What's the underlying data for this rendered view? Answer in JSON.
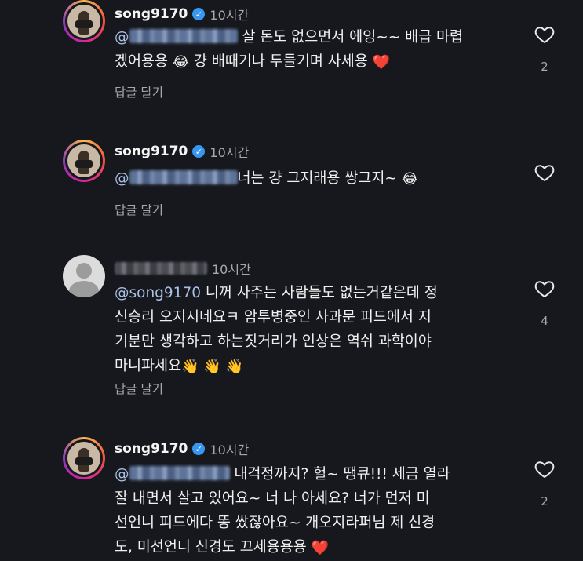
{
  "comments": [
    {
      "username": "song9170",
      "verified": true,
      "time": "10시간",
      "line1": "살 돈도 없으면서 에잉~~ 배급 마렵",
      "line2": "겠어용용",
      "line2b": "걍 배때기나 두들기며 사세용",
      "mention_prefix": "@",
      "reply_label": "답글 달기",
      "likes": "2",
      "emojis": [
        "😂",
        "❤️"
      ]
    },
    {
      "username": "song9170",
      "verified": true,
      "time": "10시간",
      "line1": "너는 걍 그지래용 쌍그지~",
      "mention_prefix": "@",
      "reply_label": "답글 달기",
      "likes": "",
      "emojis": [
        "😂"
      ]
    },
    {
      "username": "",
      "verified": false,
      "time": "10시간",
      "mention": "@song9170",
      "line1": " 니꺼 사주는 사람들도 없는거같은데 정",
      "line2": "신승리 오지시네요ㅋ 암투병중인 사과문 피드에서 지",
      "line3": "기분만 생각하고 하는짓거리가 인상은 역쉬 과학이야",
      "line4": "마니파세요",
      "reply_label": "답글 달기",
      "likes": "4",
      "emojis": [
        "👋",
        "👋",
        "👋"
      ]
    },
    {
      "username": "song9170",
      "verified": true,
      "time": "10시간",
      "line1": "내걱정까지? 헐~ 땡큐!!! 세금 열라",
      "line2": "잘 내면서 살고 있어요~ 너 나 아세요? 너가 먼저 미",
      "line3": "선언니 피드에다 똥 쌌잖아요~ 개오지라퍼님 제 신경",
      "line4": "도, 미선언니 신경도 끄세용용용",
      "mention_prefix": "@",
      "reply_label": "답글 달기",
      "likes": "2",
      "emojis": [
        "❤️"
      ]
    }
  ],
  "colors": {
    "background": "#16181d",
    "mention": "#a9bfe6",
    "verified": "#3897f0",
    "muted": "#a8a8a8"
  },
  "icons": [
    "heart-outline-icon",
    "verified-badge-icon"
  ]
}
